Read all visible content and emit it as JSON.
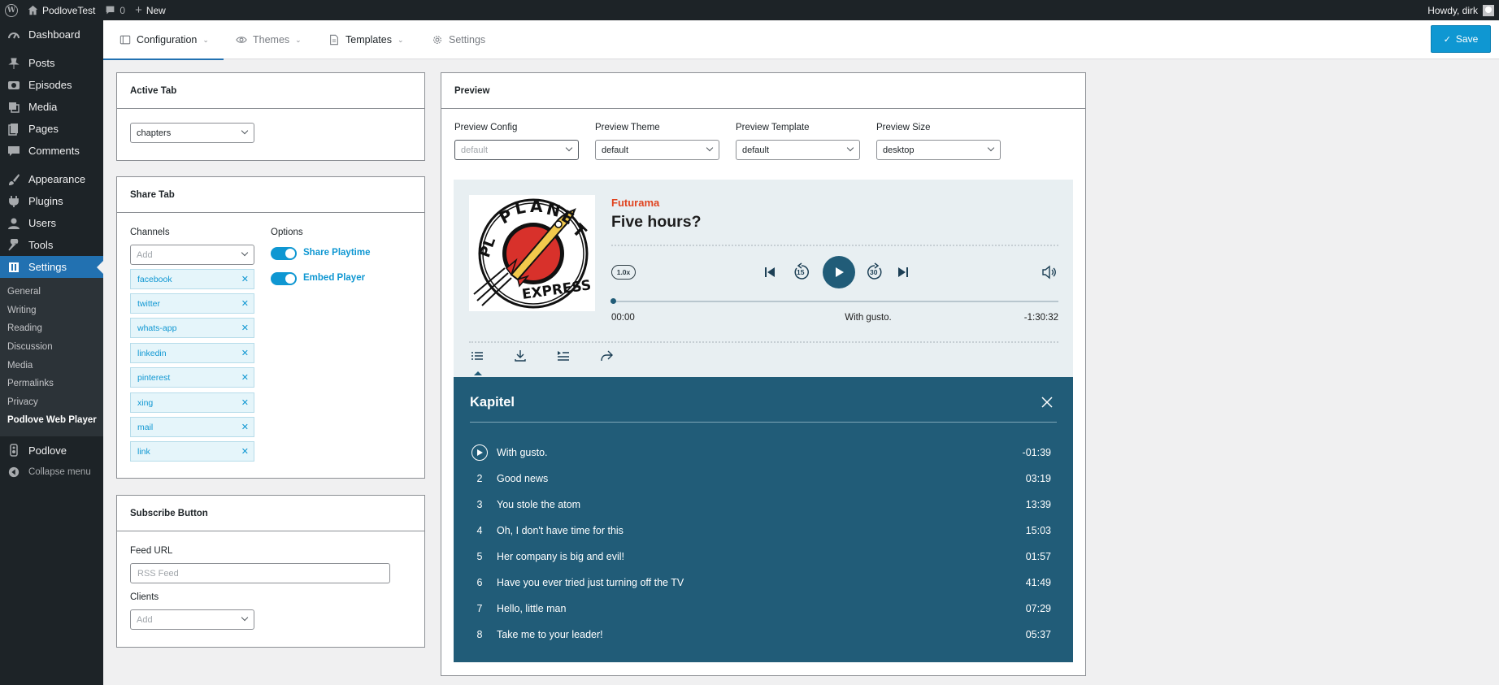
{
  "adminbar": {
    "site_name": "PodloveTest",
    "comments_count": "0",
    "new_label": "New",
    "greeting": "Howdy, dirk"
  },
  "sidebar": {
    "items": [
      {
        "label": "Dashboard",
        "icon": "dashboard-icon"
      },
      {
        "label": "Posts",
        "icon": "pin-icon"
      },
      {
        "label": "Episodes",
        "icon": "microphone-icon"
      },
      {
        "label": "Media",
        "icon": "media-icon"
      },
      {
        "label": "Pages",
        "icon": "page-icon"
      },
      {
        "label": "Comments",
        "icon": "comment-icon"
      },
      {
        "label": "Appearance",
        "icon": "brush-icon"
      },
      {
        "label": "Plugins",
        "icon": "plug-icon"
      },
      {
        "label": "Users",
        "icon": "user-icon"
      },
      {
        "label": "Tools",
        "icon": "wrench-icon"
      },
      {
        "label": "Settings",
        "icon": "settings-icon"
      }
    ],
    "submenu": [
      "General",
      "Writing",
      "Reading",
      "Discussion",
      "Media",
      "Permalinks",
      "Privacy",
      "Podlove Web Player"
    ],
    "podlove": "Podlove",
    "collapse": "Collapse menu"
  },
  "topnav": {
    "tabs": [
      "Configuration",
      "Themes",
      "Templates",
      "Settings"
    ],
    "save_label": "Save"
  },
  "active_tab": {
    "title": "Active Tab",
    "value": "chapters"
  },
  "share_tab": {
    "title": "Share Tab",
    "channels_label": "Channels",
    "channels_placeholder": "Add",
    "channels": [
      "facebook",
      "twitter",
      "whats-app",
      "linkedin",
      "pinterest",
      "xing",
      "mail",
      "link"
    ],
    "options_label": "Options",
    "options": [
      "Share Playtime",
      "Embed Player"
    ]
  },
  "subscribe": {
    "title": "Subscribe Button",
    "feed_label": "Feed URL",
    "feed_placeholder": "RSS Feed",
    "clients_label": "Clients",
    "clients_placeholder": "Add"
  },
  "preview": {
    "title": "Preview",
    "config_label": "Preview Config",
    "config_value": "default",
    "theme_label": "Preview Theme",
    "theme_value": "default",
    "template_label": "Preview Template",
    "template_value": "default",
    "size_label": "Preview Size",
    "size_value": "desktop"
  },
  "player": {
    "show": "Futurama",
    "episode": "Five hours?",
    "speed": "1.0x",
    "skip_back": "15",
    "skip_forward": "30",
    "elapsed": "00:00",
    "current_chapter": "With gusto.",
    "remaining": "-1:30:32",
    "progress_fraction": 0.0,
    "accent_color": "#e0431f",
    "primary_color": "#215c78"
  },
  "chapters": {
    "title": "Kapitel",
    "items": [
      {
        "num": "1",
        "name": "With gusto.",
        "time": "-01:39"
      },
      {
        "num": "2",
        "name": "Good news",
        "time": "03:19"
      },
      {
        "num": "3",
        "name": "You stole the atom",
        "time": "13:39"
      },
      {
        "num": "4",
        "name": "Oh, I don't have time for this",
        "time": "15:03"
      },
      {
        "num": "5",
        "name": "Her company is big and evil!",
        "time": "01:57"
      },
      {
        "num": "6",
        "name": "Have you ever tried just turning off the TV",
        "time": "41:49"
      },
      {
        "num": "7",
        "name": "Hello, little man",
        "time": "07:29"
      },
      {
        "num": "8",
        "name": "Take me to your leader!",
        "time": "05:37"
      }
    ]
  }
}
